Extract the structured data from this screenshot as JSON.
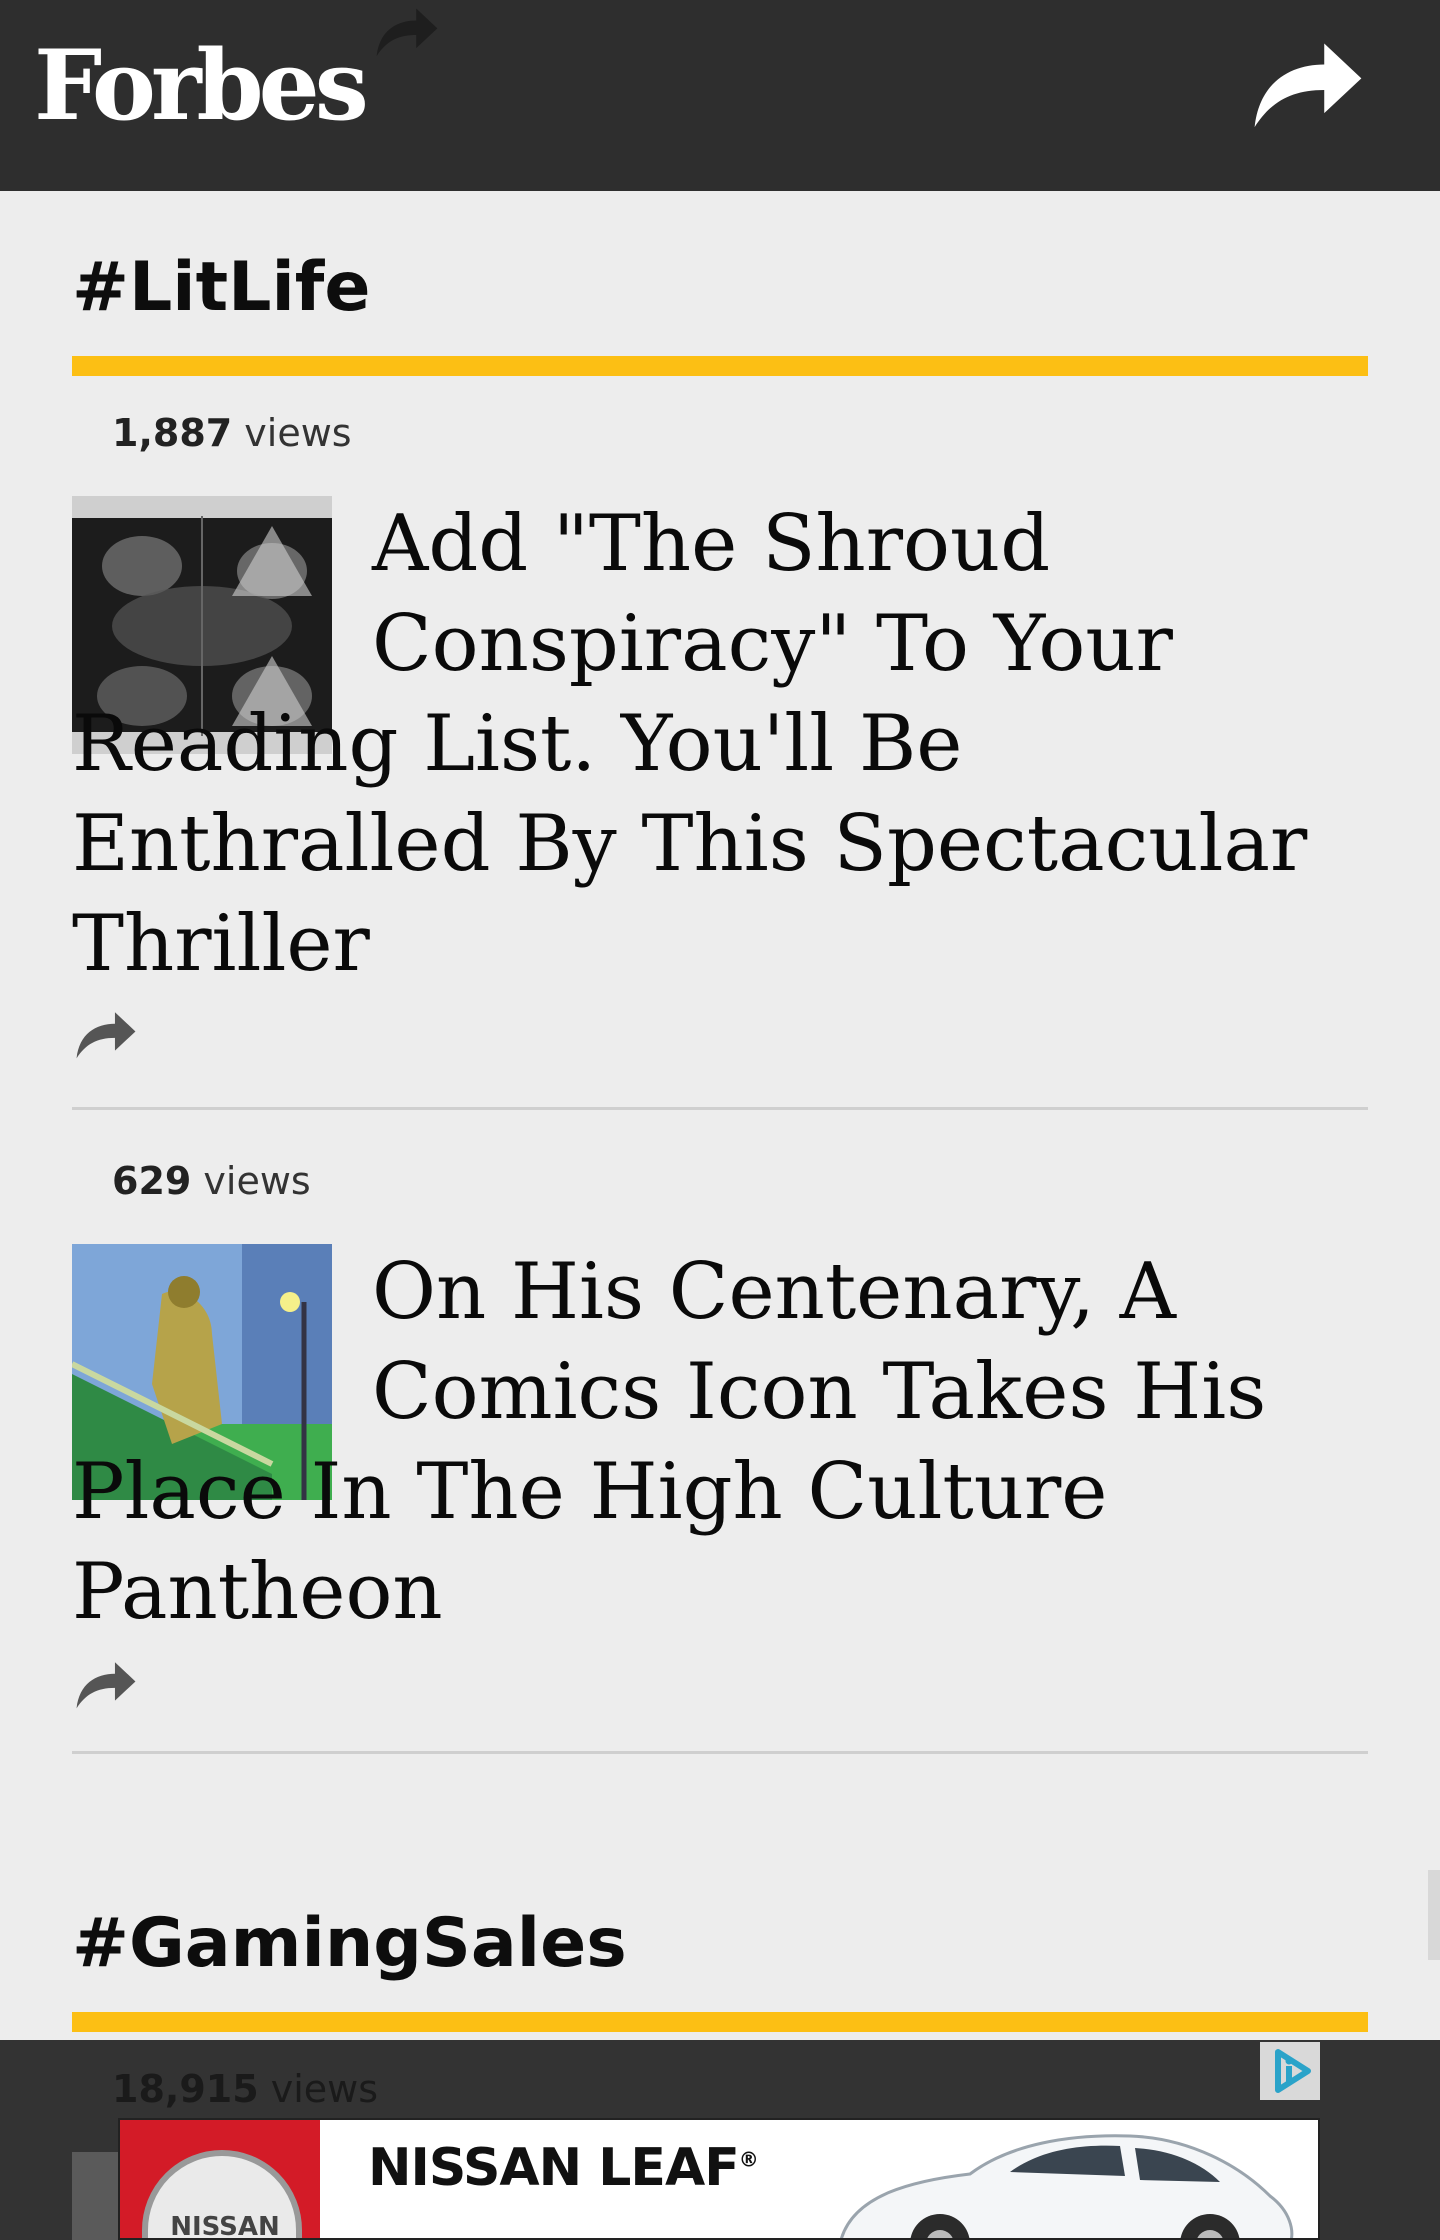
{
  "header": {
    "logo": "Forbes",
    "share_icon": "share-arrow-icon"
  },
  "sections": [
    {
      "title": "#LitLife",
      "articles": [
        {
          "views_count": "1,887",
          "views_label": "views",
          "headline": "Add \"The Shroud Conspiracy\" To Your Reading List. You'll Be Enthralled By This Spectacular Thriller",
          "thumbnail": "shroud-image"
        },
        {
          "views_count": "629",
          "views_label": "views",
          "headline": "On His Centenary, A Comics Icon Takes His Place In The High Culture Pantheon",
          "thumbnail": "comic-illustration-image"
        }
      ]
    },
    {
      "title": "#GamingSales",
      "articles": [
        {
          "views_count": "18,915",
          "views_label": "views"
        }
      ]
    }
  ],
  "ad": {
    "title": "NISSAN LEAF",
    "trademark": "®",
    "badge_text": "NISSAN",
    "choices_icon": "adchoices-icon"
  },
  "colors": {
    "header_bg": "#2e2e2e",
    "accent_bar": "#fcbf14",
    "page_bg": "#ededed",
    "ad_red": "#d31b27"
  }
}
